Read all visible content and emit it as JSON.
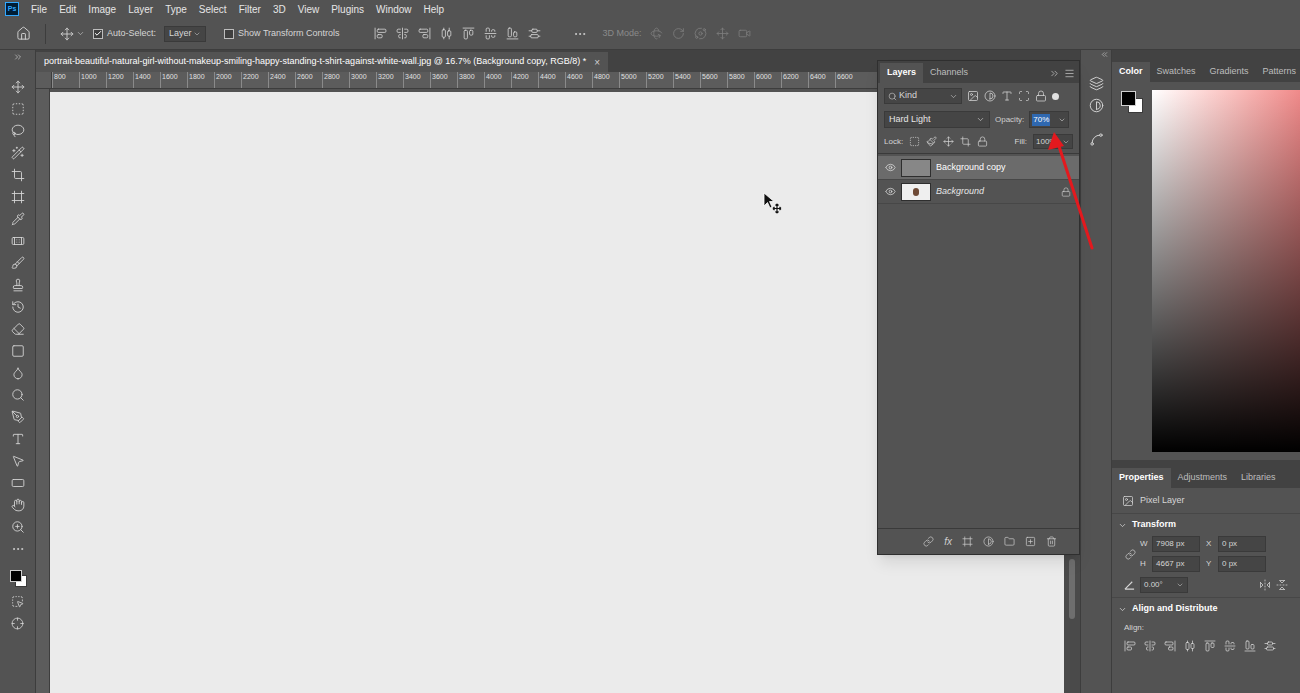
{
  "app": {
    "logo": "Ps"
  },
  "menu": [
    "File",
    "Edit",
    "Image",
    "Layer",
    "Type",
    "Select",
    "Filter",
    "3D",
    "View",
    "Plugins",
    "Window",
    "Help"
  ],
  "options_bar": {
    "auto_select": {
      "label": "Auto-Select:",
      "checked": true
    },
    "target": "Layer",
    "transform_controls": {
      "label": "Show Transform Controls",
      "checked": false
    },
    "mode_3d": {
      "label": "3D Mode:",
      "disabled": true
    }
  },
  "document": {
    "tab_title": "portrait-beautiful-natural-girl-without-makeup-smiling-happy-standing-t-shirt-against-white-wall.jpg @ 16.7% (Background copy, RGB/8) *",
    "close": "×"
  },
  "ruler": {
    "ticks": [
      "800",
      "1000",
      "1200",
      "1400",
      "1600",
      "1800",
      "2000",
      "2200",
      "2400",
      "2600",
      "2800",
      "3000",
      "3200",
      "3400",
      "3600",
      "3800",
      "4000",
      "4200",
      "4400",
      "4600",
      "4800",
      "5000",
      "5200",
      "5400",
      "5600",
      "5800",
      "6000",
      "6200",
      "6400",
      "6600"
    ]
  },
  "layers_panel": {
    "tabs": [
      {
        "label": "Layers",
        "selected": true
      },
      {
        "label": "Channels",
        "selected": false
      }
    ],
    "filter": "Kind",
    "blend_mode": "Hard Light",
    "opacity": {
      "label": "Opacity:",
      "value": "70%",
      "highlighted": true
    },
    "lock_label": "Lock:",
    "fill": {
      "label": "Fill:",
      "value": "100%"
    },
    "fx": "fx",
    "layers": [
      {
        "name": "Background copy",
        "visible": true,
        "selected": true,
        "locked": false,
        "kind": "gray"
      },
      {
        "name": "Background",
        "visible": true,
        "selected": false,
        "locked": true,
        "kind": "photo"
      }
    ]
  },
  "color_panel": {
    "tabs": [
      {
        "label": "Color",
        "selected": true
      },
      {
        "label": "Swatches",
        "selected": false
      },
      {
        "label": "Gradients",
        "selected": false
      },
      {
        "label": "Patterns",
        "selected": false
      }
    ]
  },
  "properties": {
    "tabs": [
      {
        "label": "Properties",
        "selected": true
      },
      {
        "label": "Adjustments",
        "selected": false
      },
      {
        "label": "Libraries",
        "selected": false
      }
    ],
    "layer_type": "Pixel Layer",
    "transform": {
      "title": "Transform",
      "expanded": true,
      "fields": [
        {
          "label": "W",
          "value": "7908 px"
        },
        {
          "label": "X",
          "value": "0 px"
        },
        {
          "label": "H",
          "value": "4667 px"
        },
        {
          "label": "Y",
          "value": "0 px"
        }
      ],
      "angle": "0.00°"
    },
    "align": {
      "title": "Align and Distribute",
      "expanded": true,
      "label": "Align:"
    }
  }
}
